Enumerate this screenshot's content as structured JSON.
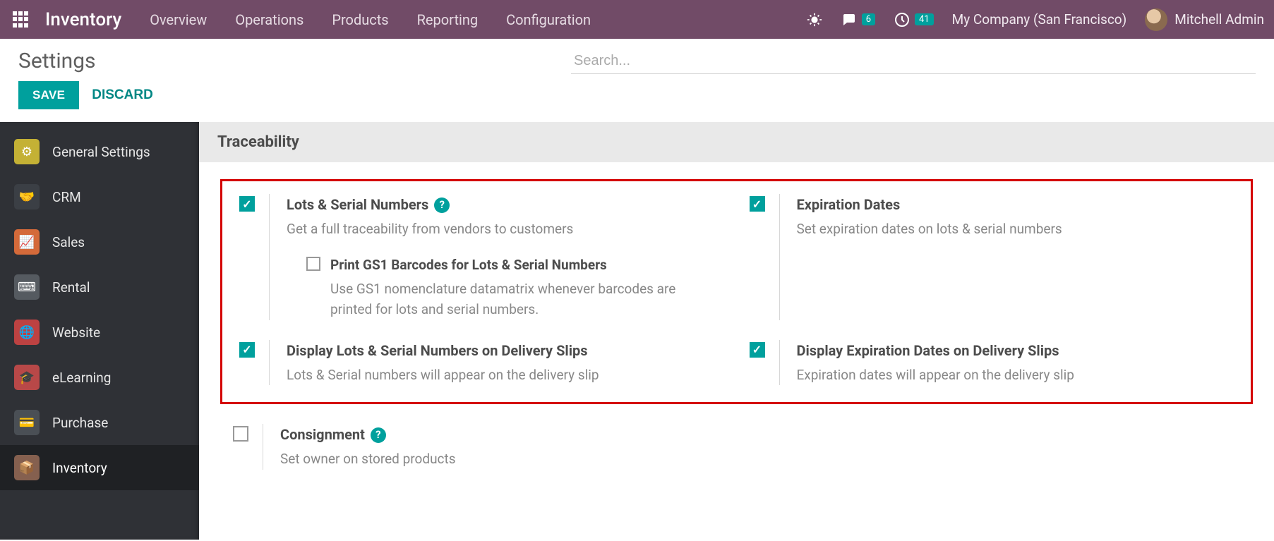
{
  "topnav": {
    "brand": "Inventory",
    "items": [
      "Overview",
      "Operations",
      "Products",
      "Reporting",
      "Configuration"
    ],
    "conversations_badge": "6",
    "activities_badge": "41",
    "company": "My Company (San Francisco)",
    "username": "Mitchell Admin"
  },
  "subhead": {
    "title": "Settings",
    "search_placeholder": "Search..."
  },
  "actions": {
    "save": "SAVE",
    "discard": "DISCARD"
  },
  "sidebar": {
    "items": [
      "General Settings",
      "CRM",
      "Sales",
      "Rental",
      "Website",
      "eLearning",
      "Purchase",
      "Inventory"
    ],
    "active_index": 7
  },
  "section": {
    "title": "Traceability"
  },
  "settings": {
    "lots": {
      "checked": true,
      "title": "Lots & Serial Numbers",
      "desc": "Get a full traceability from vendors to customers",
      "help": true,
      "sub": {
        "checked": false,
        "title": "Print GS1 Barcodes for Lots & Serial Numbers",
        "desc": "Use GS1 nomenclature datamatrix whenever barcodes are printed for lots and serial numbers."
      }
    },
    "expiration": {
      "checked": true,
      "title": "Expiration Dates",
      "desc": "Set expiration dates on lots & serial numbers"
    },
    "display_lots": {
      "checked": true,
      "title": "Display Lots & Serial Numbers on Delivery Slips",
      "desc": "Lots & Serial numbers will appear on the delivery slip"
    },
    "display_exp": {
      "checked": true,
      "title": "Display Expiration Dates on Delivery Slips",
      "desc": "Expiration dates will appear on the delivery slip"
    },
    "consignment": {
      "checked": false,
      "title": "Consignment",
      "desc": "Set owner on stored products",
      "help": true
    }
  }
}
